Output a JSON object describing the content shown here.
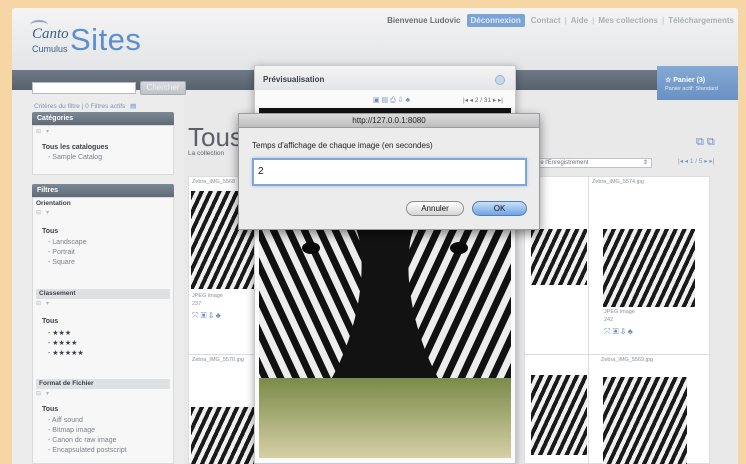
{
  "header": {
    "logo": {
      "canto": "Canto",
      "cumulus": "Cumulus",
      "sites": "Sites"
    },
    "welcome": "Bienvenue Ludovic",
    "logout": "Déconnexion",
    "links": [
      "Contact",
      "Aide",
      "Mes collections",
      "Téléchargements"
    ]
  },
  "search": {
    "placeholder": "",
    "button": "Chercher"
  },
  "breadcrumb": {
    "text": "Critères du filtre | 0 Filtres actifs"
  },
  "categories": {
    "title": "Catégories",
    "root": "Tous les catalogues",
    "items": [
      "Sample Catalog"
    ]
  },
  "filters": {
    "title": "Filtres",
    "orientation": {
      "label": "Orientation",
      "all": "Tous",
      "items": [
        "Landscape",
        "Portrait",
        "Square"
      ]
    },
    "rating": {
      "label": "Classement",
      "all": "Tous",
      "items": [
        "★★★",
        "★★★★",
        "★★★★★"
      ]
    },
    "format": {
      "label": "Format de Fichier",
      "all": "Tous",
      "items": [
        "Aiff sound",
        "Bitmap image",
        "Canon dc raw image",
        "Encapsulated postscript"
      ]
    }
  },
  "main": {
    "title": "Tous",
    "subtitle": "La collection",
    "sort": "de l'Enregistrement",
    "pager": "1 / 5"
  },
  "cart": {
    "title": "Panier (3)",
    "sub": "Panier actif: Standard"
  },
  "thumbs": [
    {
      "caption": "Zebra_IMG_5568",
      "type": "JPEG image",
      "num": "237"
    },
    {
      "caption": "Zebra_IMG_5574.jpg",
      "type": "JPEG image",
      "num": "242"
    },
    {
      "caption": "Zebra_IMG_5570.jpg",
      "type": "",
      "num": ""
    },
    {
      "caption": "Zebra_IMG_5569.jpg",
      "type": "",
      "num": ""
    }
  ],
  "preview": {
    "title": "Prévisualisation",
    "page": "2 / 31"
  },
  "dialog": {
    "title": "http://127.0.0.1:8080",
    "message": "Temps d'affichage de chaque image (en secondes)",
    "value": "2",
    "cancel": "Annuler",
    "ok": "OK"
  }
}
